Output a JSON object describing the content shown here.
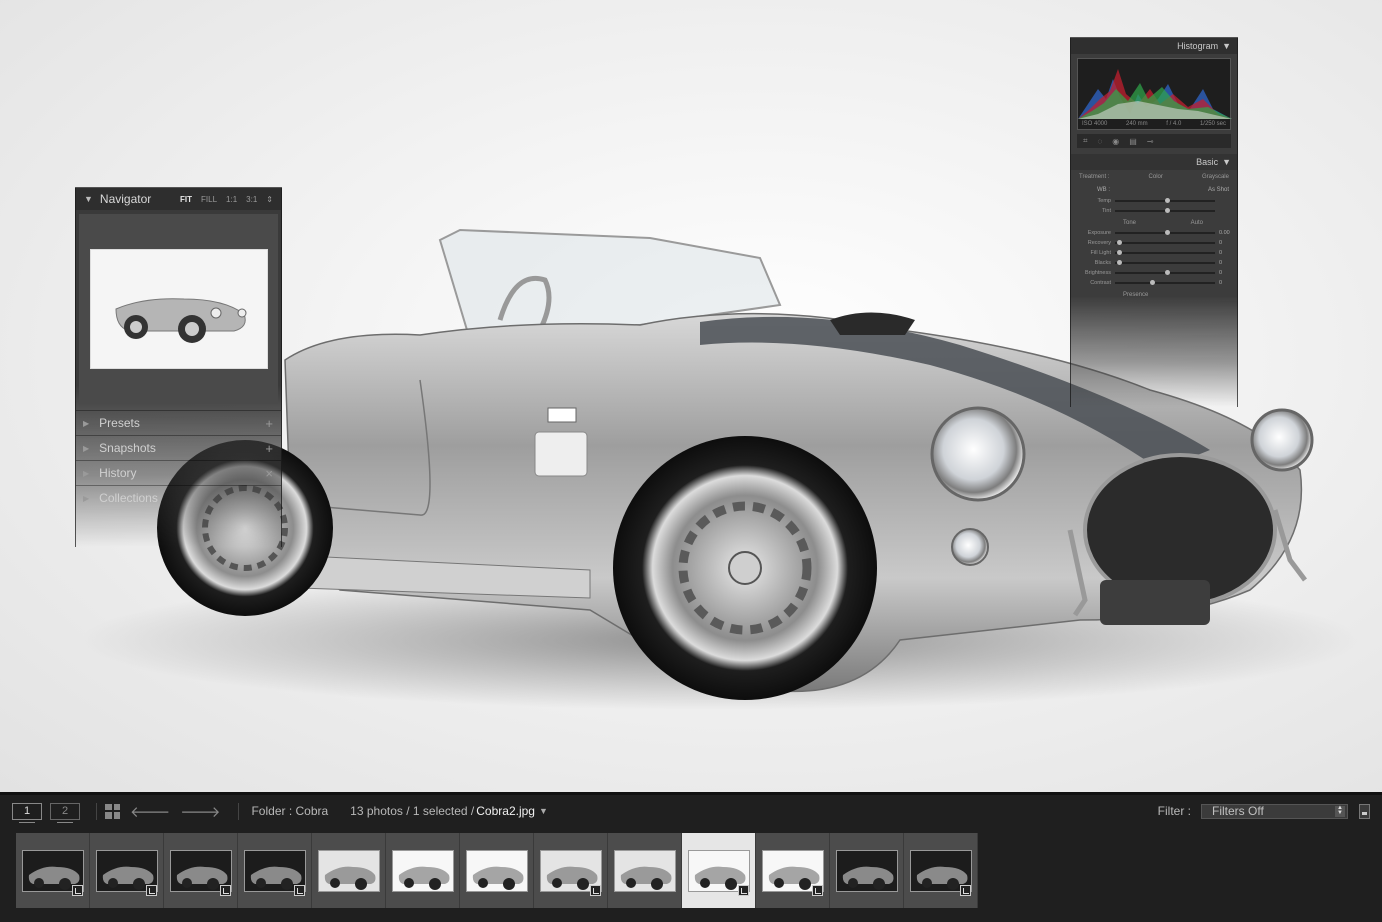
{
  "navigator": {
    "title": "Navigator",
    "zoom_options": [
      "FIT",
      "FILL",
      "1:1",
      "3:1"
    ],
    "sections": [
      {
        "label": "Presets",
        "action": "+"
      },
      {
        "label": "Snapshots",
        "action": "+"
      },
      {
        "label": "History",
        "action": "×"
      },
      {
        "label": "Collections",
        "action": ""
      }
    ]
  },
  "develop": {
    "histogram_label": "Histogram",
    "histogram_info": [
      "ISO 4000",
      "240 mm",
      "f / 4.0",
      "1/250 sec"
    ],
    "basic_label": "Basic",
    "treatment_label": "Treatment :",
    "treatment_options": [
      "Color",
      "Grayscale"
    ],
    "wb_label": "WB :",
    "wb_value": "As Shot",
    "tone_label": "Tone",
    "auto_label": "Auto",
    "sliders": [
      {
        "label": "Temp",
        "pos": 0.5,
        "value": ""
      },
      {
        "label": "Tint",
        "pos": 0.5,
        "value": ""
      },
      {
        "label": "Exposure",
        "pos": 0.5,
        "value": "0.00"
      },
      {
        "label": "Recovery",
        "pos": 0.02,
        "value": "0"
      },
      {
        "label": "Fill Light",
        "pos": 0.02,
        "value": "0"
      },
      {
        "label": "Blacks",
        "pos": 0.02,
        "value": "0"
      },
      {
        "label": "Brightness",
        "pos": 0.5,
        "value": "0"
      },
      {
        "label": "Contrast",
        "pos": 0.35,
        "value": "0"
      }
    ],
    "presence_label": "Presence"
  },
  "filmstrip": {
    "monitor_1": "1",
    "monitor_2": "2",
    "folder": "Folder : Cobra",
    "count": "13 photos / 1 selected /",
    "filename": "Cobra2.jpg",
    "filter_label": "Filter :",
    "filter_value": "Filters Off",
    "selected_index": 9,
    "thumbs": [
      {
        "tone": "dark",
        "badge": true
      },
      {
        "tone": "dark",
        "badge": true
      },
      {
        "tone": "dark",
        "badge": true
      },
      {
        "tone": "dark",
        "badge": true
      },
      {
        "tone": "light",
        "badge": false
      },
      {
        "tone": "white",
        "badge": false
      },
      {
        "tone": "white",
        "badge": false
      },
      {
        "tone": "light",
        "badge": true
      },
      {
        "tone": "light",
        "badge": false
      },
      {
        "tone": "white",
        "badge": true
      },
      {
        "tone": "white",
        "badge": true
      },
      {
        "tone": "dark",
        "badge": false
      },
      {
        "tone": "dark",
        "badge": true
      }
    ]
  }
}
